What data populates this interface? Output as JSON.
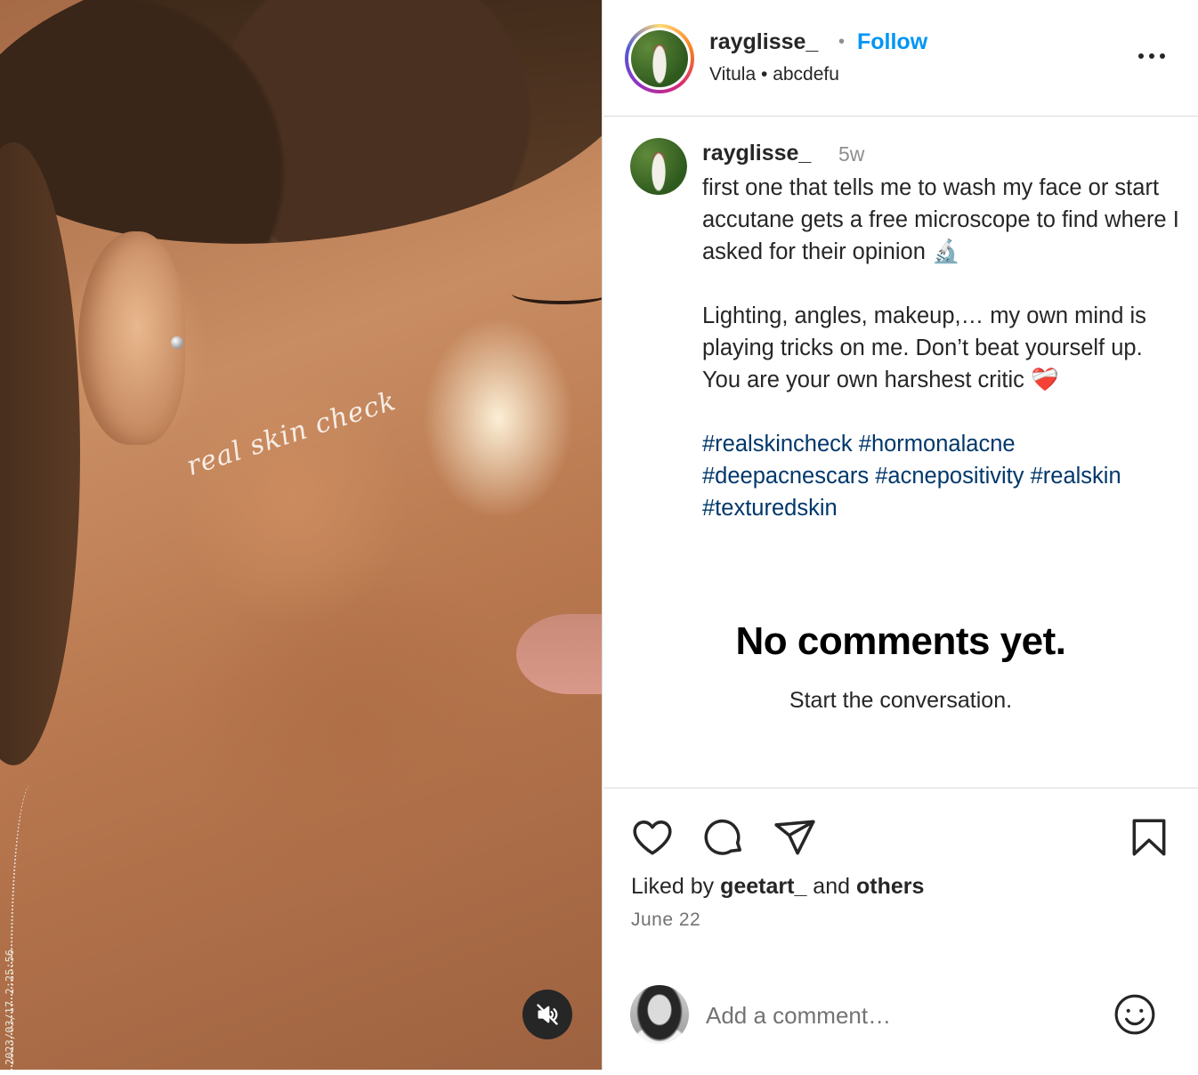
{
  "post": {
    "media": {
      "overlay_text": "real skin check",
      "timestamp": "2023/03/17  2:25:56",
      "mute_icon": "speaker-muted-icon"
    },
    "header": {
      "username": "rayglisse_",
      "separator": "•",
      "follow_label": "Follow",
      "location": "Vitula",
      "sub_separator": "•",
      "audio": "abcdefu",
      "more_icon": "more-options-icon"
    },
    "caption": {
      "username": "rayglisse_",
      "age": "5w",
      "paragraph1": "first one that tells me to wash my face or start accutane gets a free microscope to find where I asked for their opinion 🔬",
      "paragraph2": "Lighting, angles, makeup,… my own mind is playing tricks on me. Don’t beat yourself up. You are your own harshest critic ❤️‍🩹",
      "hashtags": [
        "#realskincheck",
        "#hormonalacne",
        "#deepacnescars",
        "#acnepositivity",
        "#realskin",
        "#texturedskin"
      ]
    },
    "comments_empty": {
      "title": "No comments yet.",
      "subtitle": "Start the conversation."
    },
    "actions": {
      "like_icon": "heart-icon",
      "comment_icon": "comment-bubble-icon",
      "share_icon": "paper-plane-icon",
      "save_icon": "bookmark-icon"
    },
    "likes": {
      "prefix": "Liked by",
      "user": "geetart_",
      "connector": "and",
      "others": "others"
    },
    "date": "June 22",
    "comment_box": {
      "placeholder": "Add a comment…",
      "emoji_icon": "smiley-face-icon"
    },
    "colors": {
      "link_blue": "#0095f6",
      "hashtag_blue": "#00376b",
      "muted_gray": "#737373",
      "divider": "#dbdbdb"
    }
  }
}
